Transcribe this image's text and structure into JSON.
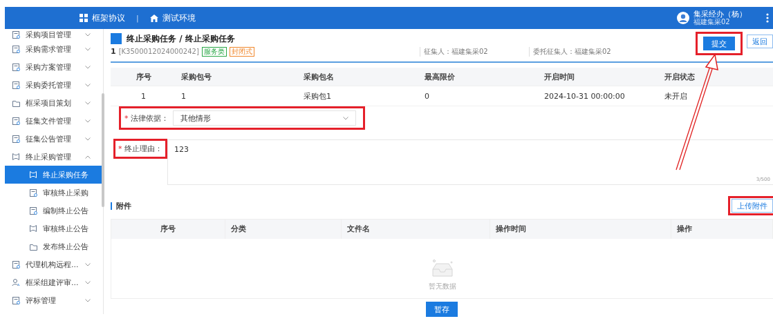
{
  "header": {
    "app_title": "框架协议",
    "separator": "|",
    "environment": "测试环境",
    "user": {
      "name": "集采经办（杨）",
      "org": "福建集采02"
    }
  },
  "sidebar": {
    "items": [
      {
        "label": "采购项目管理",
        "kind": "doc",
        "expanded": false
      },
      {
        "label": "采购需求管理",
        "kind": "doc",
        "expanded": false
      },
      {
        "label": "采购方案管理",
        "kind": "doc",
        "expanded": false
      },
      {
        "label": "采购委托管理",
        "kind": "doc",
        "expanded": false
      },
      {
        "label": "框采项目策划",
        "kind": "folder",
        "expanded": false
      },
      {
        "label": "征集文件管理",
        "kind": "doc",
        "expanded": false
      },
      {
        "label": "征集公告管理",
        "kind": "doc",
        "expanded": false
      },
      {
        "label": "终止采购管理",
        "kind": "frame",
        "expanded": true,
        "children": [
          {
            "label": "终止采购任务",
            "kind": "frame",
            "selected": true
          },
          {
            "label": "审核终止采购",
            "kind": "doc",
            "selected": false
          },
          {
            "label": "编制终止公告",
            "kind": "doc",
            "selected": false
          },
          {
            "label": "审核终止公告",
            "kind": "frame",
            "selected": false
          },
          {
            "label": "发布终止公告",
            "kind": "folder",
            "selected": false
          }
        ]
      },
      {
        "label": "代理机构远程...",
        "kind": "doc",
        "expanded": false
      },
      {
        "label": "框采组建评审...",
        "kind": "person",
        "expanded": false
      },
      {
        "label": "评标管理",
        "kind": "doc",
        "expanded": false
      }
    ]
  },
  "task": {
    "title": "终止采购任务 / 终止采购任务",
    "index": "1",
    "code": "[K3500012024000242]",
    "tags": [
      {
        "text": "服务类",
        "color": "#28a745"
      },
      {
        "text": "封闭式",
        "color": "#f0862a"
      }
    ],
    "meta": [
      "征集人：福建集采02",
      "委托征集人：福建集采02"
    ],
    "buttons": [
      {
        "label": "提交",
        "kind": "primary",
        "highlighted": true
      },
      {
        "label": "返回",
        "kind": "outline",
        "highlighted": false
      }
    ]
  },
  "packages": {
    "columns": [
      "序号",
      "采购包号",
      "采购包名",
      "最高限价",
      "开启时间",
      "开启状态"
    ],
    "rows": [
      [
        "1",
        "1",
        "采购包1",
        "0",
        "2024-10-31 00:00:00",
        "未开启"
      ]
    ]
  },
  "form": {
    "legal_basis": {
      "required_mark": "*",
      "label": "法律依据：",
      "value": "其他情形",
      "highlighted": true
    },
    "reason": {
      "required_mark": "*",
      "label": "终止理由：",
      "value": "123",
      "counter": "3/500",
      "highlighted": true
    }
  },
  "attachments": {
    "title": "附件",
    "upload_button": {
      "label": "上传附件",
      "highlighted": true
    },
    "columns": [
      "序号",
      "分类",
      "文件名",
      "操作时间",
      "操作"
    ],
    "empty_text": "暂无数据"
  },
  "save_button": "暂存",
  "annotation_arrow": {
    "visible": true
  }
}
